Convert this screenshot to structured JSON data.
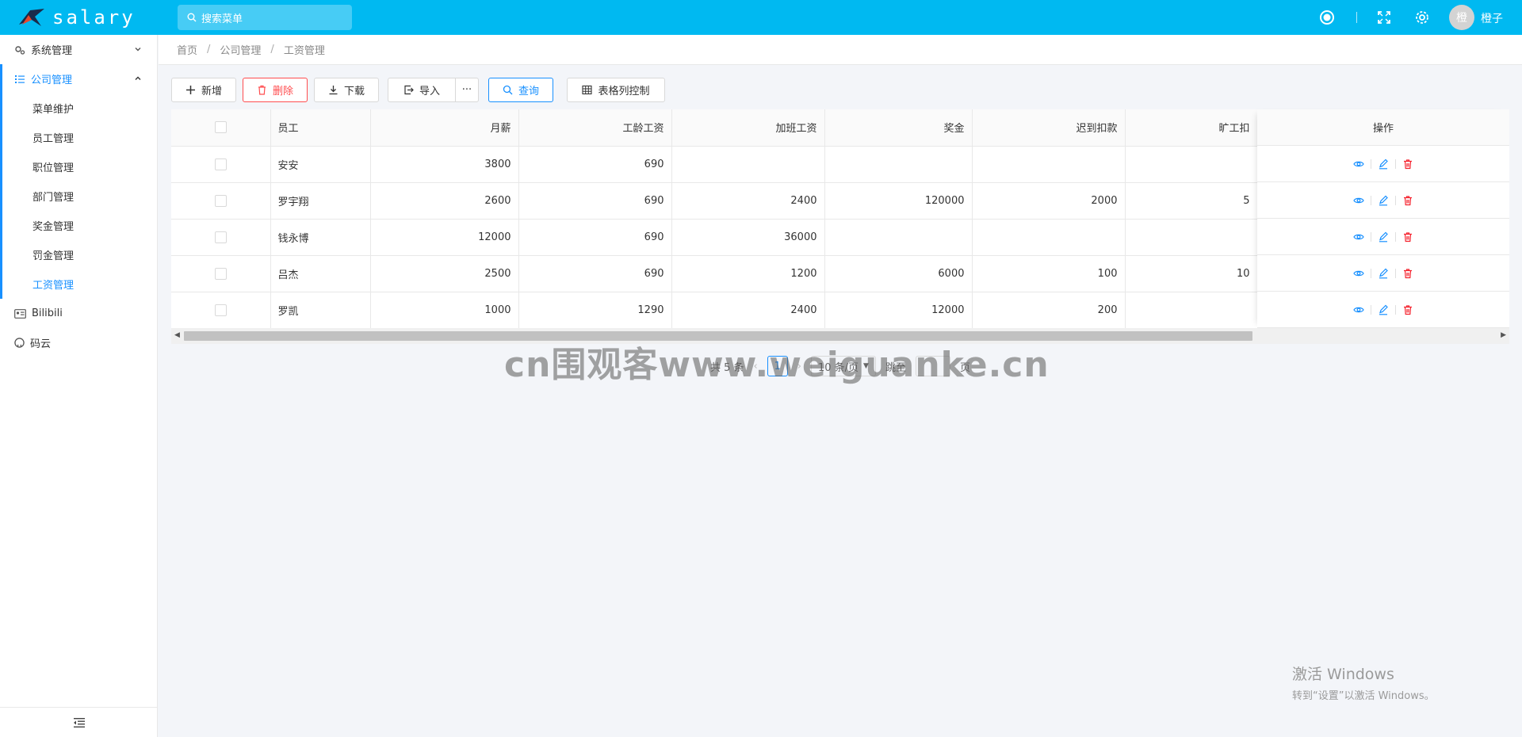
{
  "app": {
    "title": "salary"
  },
  "header": {
    "search_placeholder": "搜索菜单",
    "username": "橙子",
    "avatar_text": "橙"
  },
  "sidebar": {
    "items": [
      {
        "label": "系统管理",
        "icon": "gears-icon",
        "expanded": false
      },
      {
        "label": "公司管理",
        "icon": "list-icon",
        "expanded": true,
        "children": [
          "菜单维护",
          "员工管理",
          "职位管理",
          "部门管理",
          "奖金管理",
          "罚金管理",
          "工资管理"
        ],
        "active_child": "工资管理"
      },
      {
        "label": "Bilibili",
        "icon": "idcard-icon"
      },
      {
        "label": "码云",
        "icon": "github-icon"
      }
    ]
  },
  "breadcrumb": [
    "首页",
    "公司管理",
    "工资管理"
  ],
  "toolbar": {
    "add": "新增",
    "delete": "删除",
    "download": "下载",
    "import": "导入",
    "more": "···",
    "query": "查询",
    "columns": "表格列控制"
  },
  "table": {
    "columns": [
      "员工",
      "月薪",
      "工龄工资",
      "加班工资",
      "奖金",
      "迟到扣款",
      "旷工扣"
    ],
    "ops_header": "操作",
    "rows": [
      [
        "安安",
        "3800",
        "690",
        "",
        "",
        "",
        ""
      ],
      [
        "罗宇翔",
        "2600",
        "690",
        "2400",
        "120000",
        "2000",
        "5"
      ],
      [
        "钱永博",
        "12000",
        "690",
        "36000",
        "",
        "",
        ""
      ],
      [
        "吕杰",
        "2500",
        "690",
        "1200",
        "6000",
        "100",
        "10"
      ],
      [
        "罗凯",
        "1000",
        "1290",
        "2400",
        "12000",
        "200",
        ""
      ]
    ]
  },
  "pagination": {
    "total": "共 5 条",
    "current": "1",
    "page_size": "10 条/页",
    "goto": "跳至",
    "page_unit": "页"
  },
  "watermark": "cn围观客www.weiguanke.cn",
  "os_notice": {
    "line1": "激活 Windows",
    "line2": "转到“设置”以激活 Windows。"
  }
}
